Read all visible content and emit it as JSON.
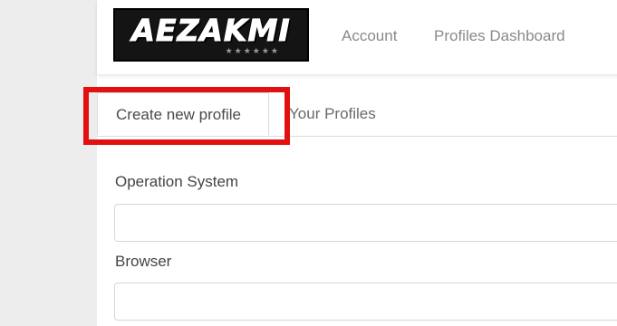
{
  "header": {
    "logo_text": "AEZAKMI",
    "logo_stars": "★★★★★★",
    "nav": {
      "account": "Account",
      "profiles_dashboard": "Profiles Dashboard"
    }
  },
  "tabs": [
    {
      "label": "Create new profile",
      "active": true
    },
    {
      "label": "Your Profiles",
      "active": false
    }
  ],
  "form": {
    "os_label": "Operation System",
    "os_value": "",
    "browser_label": "Browser",
    "browser_value": ""
  },
  "colors": {
    "highlight_border": "#e21010",
    "nav_link": "#8a8a8a"
  }
}
